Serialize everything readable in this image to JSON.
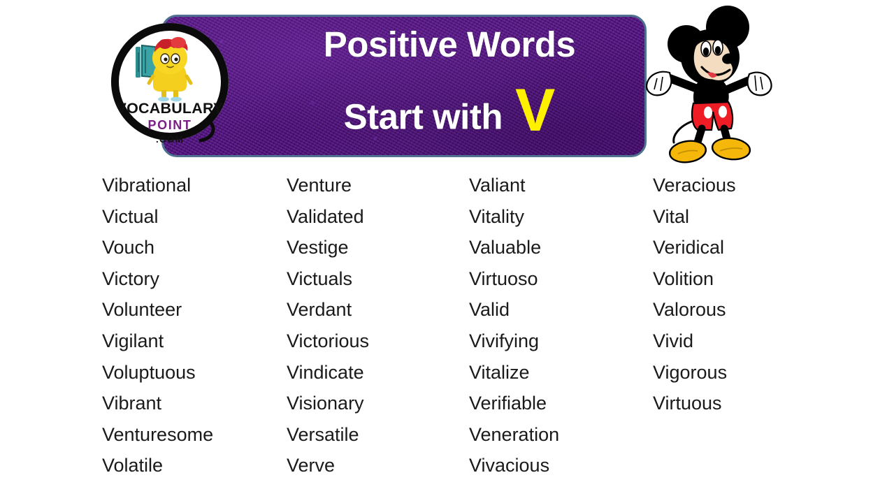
{
  "banner": {
    "title_line1": "Positive Words",
    "title_line2": "Start with",
    "highlight_letter": "V",
    "background_color": "#4d1175",
    "border_color": "#4e7290",
    "title_color": "#ffffff",
    "letter_color": "#fff000"
  },
  "logo": {
    "brand_line1": "VOCABULARY",
    "brand_line2": "POINT",
    "brand_line3": ".COM",
    "brand_line1_color": "#111111",
    "brand_line2_color": "#7a1f86",
    "brand_line3_color": "#111111",
    "alt": "vocabulary-point-logo"
  },
  "mascot": {
    "alt": "mickey-mouse-character",
    "body_color": "#000000",
    "shorts_color": "#ee1c25",
    "shoes_color": "#f5b70a",
    "face_color": "#f5dbbd",
    "glove_color": "#ffffff"
  },
  "word_list": {
    "text_color": "#1a1a1a",
    "columns": [
      {
        "index": 0,
        "words": [
          "Vibrational",
          "Victual",
          "Vouch",
          "Victory",
          "Volunteer",
          "Vigilant",
          "Voluptuous",
          "Vibrant",
          "Venturesome",
          "Volatile"
        ]
      },
      {
        "index": 1,
        "words": [
          "Venture",
          "Validated",
          "Vestige",
          "Victuals",
          "Verdant",
          "Victorious",
          "Vindicate",
          "Visionary",
          "Versatile",
          "Verve"
        ]
      },
      {
        "index": 2,
        "words": [
          "Valiant",
          "Vitality",
          "Valuable",
          "Virtuoso",
          "Valid",
          "Vivifying",
          "Vitalize",
          "Verifiable",
          "Veneration",
          "Vivacious"
        ]
      },
      {
        "index": 3,
        "words": [
          "Veracious",
          "Vital",
          "Veridical",
          "Volition",
          "Valorous",
          "Vivid",
          "Vigorous",
          "Virtuous"
        ]
      }
    ]
  }
}
